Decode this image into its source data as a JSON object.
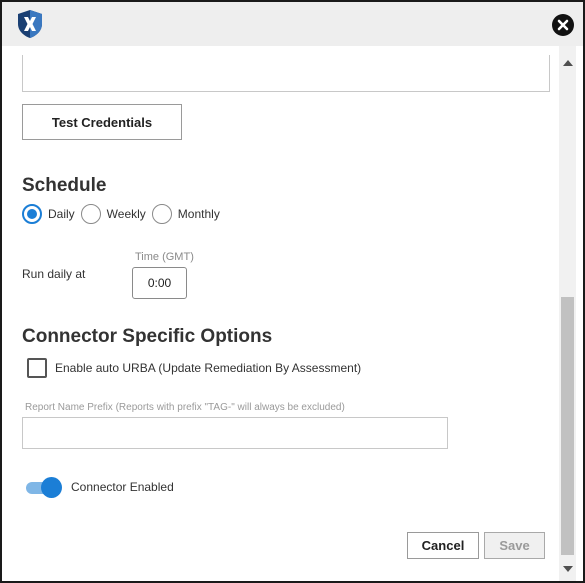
{
  "dialog": {
    "close_icon": "close-icon",
    "logo_icon": "shield-x-logo-icon"
  },
  "credentials": {
    "test_button_label": "Test Credentials"
  },
  "schedule": {
    "title": "Schedule",
    "options": [
      {
        "label": "Daily",
        "checked": true
      },
      {
        "label": "Weekly",
        "checked": false
      },
      {
        "label": "Monthly",
        "checked": false
      }
    ],
    "run_label": "Run daily at",
    "time_label": "Time (GMT)",
    "time_value": "0:00"
  },
  "connector_options": {
    "title": "Connector Specific Options",
    "auto_urba_label": "Enable auto URBA (Update Remediation By Assessment)",
    "auto_urba_checked": false,
    "prefix_label": "Report Name Prefix (Reports with prefix \"TAG-\" will always be excluded)",
    "prefix_value": "",
    "enabled_label": "Connector Enabled",
    "enabled": true
  },
  "footer": {
    "cancel_label": "Cancel",
    "save_label": "Save"
  },
  "colors": {
    "accent": "#1b7ed6",
    "toggle_track": "#7fb6e6",
    "logo_dark": "#1a3f73",
    "logo_light": "#3a78c0"
  }
}
